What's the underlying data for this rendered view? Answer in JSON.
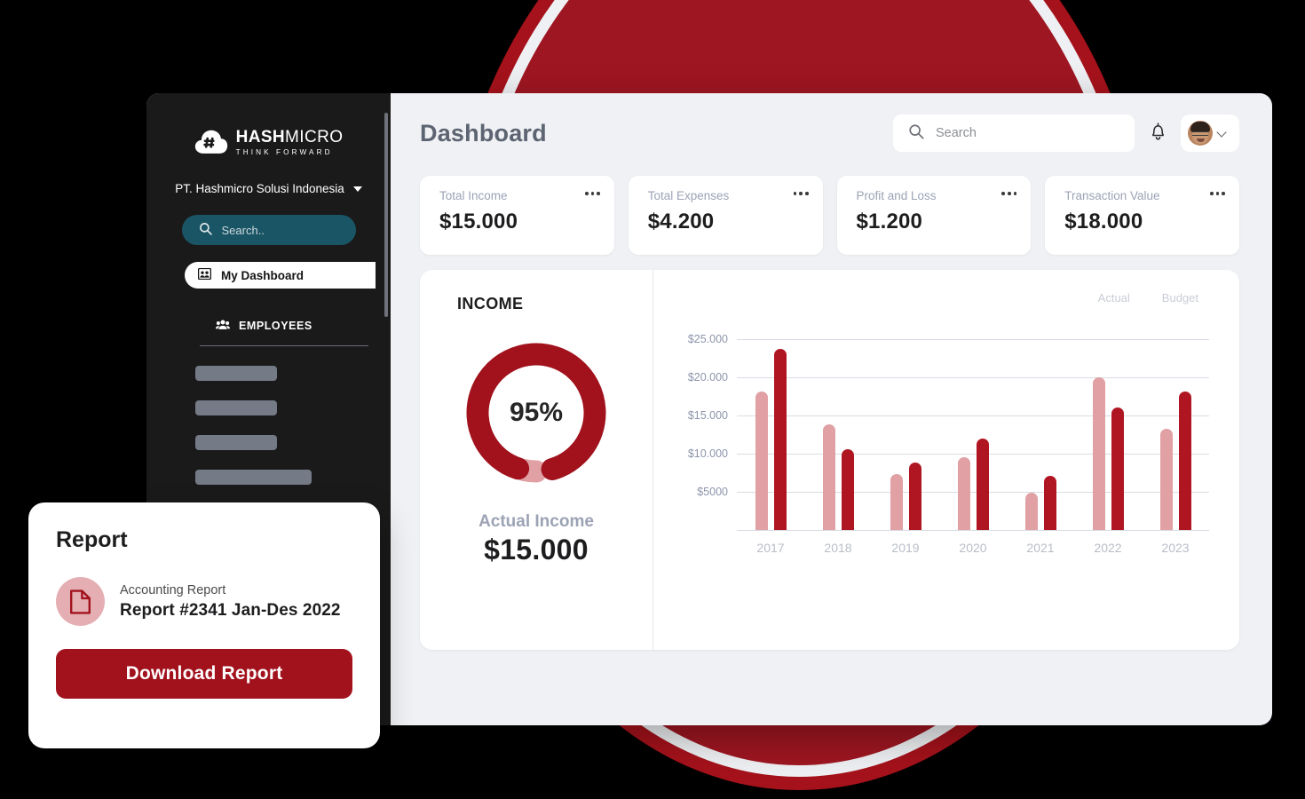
{
  "theme": {
    "brand_red": "#A1121D",
    "brand_red_dark": "#9E1621",
    "bar_actual": "#E0A0A4",
    "bar_budget": "#B01622",
    "sidebar_bg": "#1A1A1A",
    "sidebar_search_bg": "#1A5566",
    "app_bg": "#EFF1F4",
    "muted_text": "#9CA3B5"
  },
  "sidebar": {
    "logo": {
      "main_bold": "HASH",
      "main_light": "MICRO",
      "tagline": "THINK FORWARD",
      "icon": "hashmicro-cloud-logo"
    },
    "company": {
      "name": "PT. Hashmicro Solusi Indonesia",
      "caret": "chevron-down-icon"
    },
    "search": {
      "placeholder": "Search..",
      "icon": "search-icon"
    },
    "active_item": {
      "label": "My Dashboard",
      "icon": "dashboard-icon"
    },
    "section": {
      "label": "EMPLOYEES",
      "icon": "people-icon"
    },
    "skeleton_widths": [
      92,
      92,
      92,
      131,
      131
    ]
  },
  "header": {
    "title": "Dashboard",
    "search": {
      "placeholder": "Search",
      "value": "",
      "icon": "search-icon"
    },
    "notifications_icon": "bell-icon",
    "avatar": {
      "name": "user-avatar",
      "caret": "chevron-down-icon"
    }
  },
  "kpis": [
    {
      "label": "Total Income",
      "value": "$15.000",
      "menu": "more-options-icon"
    },
    {
      "label": "Total Expenses",
      "value": "$4.200",
      "menu": "more-options-icon"
    },
    {
      "label": "Profit and Loss",
      "value": "$1.200",
      "menu": "more-options-icon"
    },
    {
      "label": "Transaction Value",
      "value": "$18.000",
      "menu": "more-options-icon"
    }
  ],
  "income_panel": {
    "title": "INCOME",
    "donut_percent_label": "95%",
    "actual_label": "Actual Income",
    "actual_value": "$15.000"
  },
  "chart_data": {
    "type": "bar",
    "title": "INCOME",
    "xlabel": "",
    "ylabel": "",
    "grid": true,
    "legend_position": "top-right",
    "categories": [
      "2017",
      "2018",
      "2019",
      "2020",
      "2021",
      "2022",
      "2023"
    ],
    "ytick_labels": [
      "$25.000",
      "$20.000",
      "$15.000",
      "$10.000",
      "$5000"
    ],
    "yticks": [
      25000,
      20000,
      15000,
      10000,
      5000
    ],
    "ylim": [
      0,
      27000
    ],
    "series": [
      {
        "name": "Actual",
        "color": "#E0A0A4",
        "values": [
          18200,
          13900,
          7300,
          9500,
          4900,
          20000,
          13300
        ]
      },
      {
        "name": "Budget",
        "color": "#B01622",
        "values": [
          23800,
          10600,
          8800,
          12000,
          7100,
          16100,
          18100
        ]
      }
    ],
    "donut": {
      "type": "donut",
      "percent": 95,
      "center_label": "95%",
      "segments": [
        {
          "name": "Achieved",
          "value": 95,
          "color": "#A1121D"
        },
        {
          "name": "Remaining",
          "value": 5,
          "color": "#E0A0A4"
        }
      ]
    }
  },
  "report_card": {
    "title": "Report",
    "icon": "document-icon",
    "subtitle": "Accounting Report",
    "name": "Report #2341 Jan-Des 2022",
    "button_label": "Download Report"
  }
}
